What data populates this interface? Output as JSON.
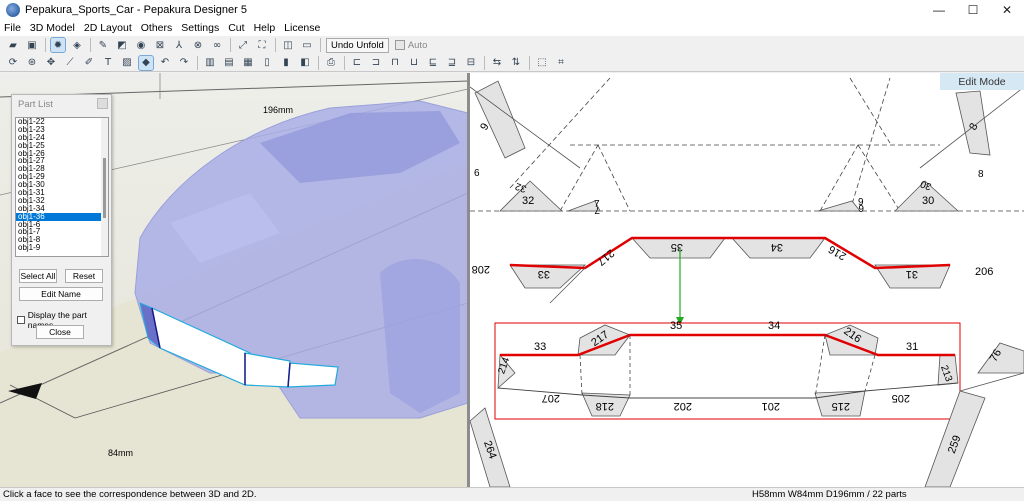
{
  "window": {
    "title": "Pepakura_Sports_Car - Pepakura Designer 5",
    "controls": {
      "minimize": "—",
      "maximize": "☐",
      "close": "✕"
    }
  },
  "menu": [
    "File",
    "3D Model",
    "2D Layout",
    "Others",
    "Settings",
    "Cut",
    "Help",
    "License"
  ],
  "toolbar": {
    "undo_unfold": "Undo Unfold",
    "auto": "Auto"
  },
  "view3d": {
    "dim_width": "196mm",
    "dim_depth": "84mm"
  },
  "view2d": {
    "mode": "Edit Mode",
    "labels": {
      "l9": "9",
      "l8": "8",
      "l6a": "6",
      "l8b": "8",
      "l32": "32",
      "l32b": "32",
      "l7": "7",
      "l7b": "7",
      "l9b": "9",
      "l6b": "6",
      "l30": "30",
      "l30b": "30",
      "l35top": "35",
      "l34top": "34",
      "l217top": "217",
      "l216top": "216",
      "l33top": "33",
      "l31top": "31",
      "l208": "208",
      "l206top": "206",
      "l33": "33",
      "l217": "217",
      "l35": "35",
      "l34": "34",
      "l216": "216",
      "l31": "31",
      "l214": "214",
      "l213": "213",
      "l207": "207",
      "l218": "218",
      "l202": "202",
      "l201": "201",
      "l215": "215",
      "l205": "205",
      "l76": "76",
      "l264": "264",
      "l259": "259"
    }
  },
  "part_list": {
    "title": "Part List",
    "items": [
      "obj1-22",
      "obj1-23",
      "obj1-24",
      "obj1-25",
      "obj1-26",
      "obj1-27",
      "obj1-28",
      "obj1-29",
      "obj1-30",
      "obj1-31",
      "obj1-32",
      "obj1-34",
      "obj1-36",
      "obj1-6",
      "obj1-7",
      "obj1-8",
      "obj1-9"
    ],
    "selected": "obj1-36",
    "select_all": "Select All",
    "reset": "Reset",
    "edit_name": "Edit Name",
    "display_names": "Display the part names",
    "close": "Close"
  },
  "status": {
    "hint": "Click a face to see the correspondence between 3D and 2D.",
    "dimensions": "H58mm W84mm D196mm / 22 parts"
  },
  "colors": {
    "accent": "#0078d7",
    "highlight_red": "#e00000",
    "connector_green": "#22aa22",
    "model_fill": "#a9aee6",
    "edit_mode_bg": "#d7e8f5"
  }
}
